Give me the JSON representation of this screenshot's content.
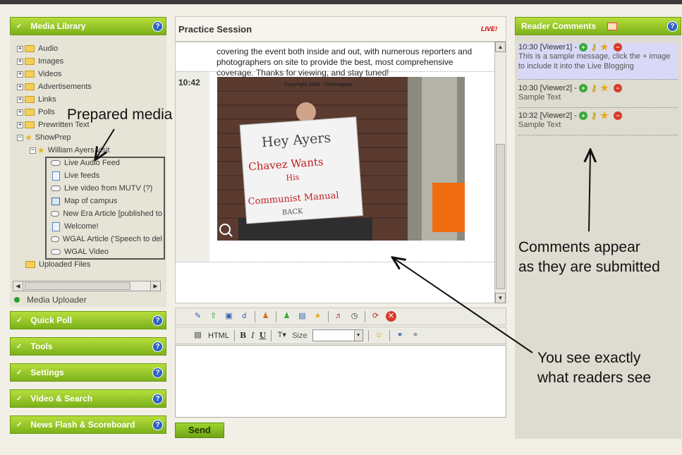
{
  "left_panel": {
    "media_library": "Media Library",
    "tree": [
      {
        "label": "Audio"
      },
      {
        "label": "Images"
      },
      {
        "label": "Videos"
      },
      {
        "label": "Advertisements"
      },
      {
        "label": "Links"
      },
      {
        "label": "Polls"
      },
      {
        "label": "Prewritten Text"
      },
      {
        "label": "ShowPrep"
      }
    ],
    "showprep_child": "William Ayers visit",
    "media_items": [
      {
        "label": "Live Audio Feed",
        "icon": "link-icon"
      },
      {
        "label": "Live feeds",
        "icon": "document-icon"
      },
      {
        "label": "Live video from MUTV (?)",
        "icon": "link-icon"
      },
      {
        "label": "Map of campus",
        "icon": "image-icon"
      },
      {
        "label": "New Era Article [published to",
        "icon": "link-icon"
      },
      {
        "label": "Welcome!",
        "icon": "document-icon"
      },
      {
        "label": "WGAL Article ('Speech to del",
        "icon": "link-icon"
      },
      {
        "label": "WGAL Video",
        "icon": "link-icon"
      }
    ],
    "uploaded_files": "Uploaded Files",
    "media_uploader": "Media Uploader",
    "panels": [
      "Quick Poll",
      "Tools",
      "Settings",
      "Video & Search",
      "News Flash & Scoreboard"
    ]
  },
  "session": {
    "title": "Practice Session",
    "live": "LIVE!",
    "intro_text": "covering the event both inside and out, with numerous reporters and photographers on site to provide the best, most comprehensive coverage. Thanks for viewing, and stay tuned!",
    "post_time": "10:42",
    "photo": {
      "copyright": "Copyright 2008 - TheSnapper",
      "sign_lines": [
        "Hey Ayers",
        "Chavez Wants",
        "His",
        "Communist Manual",
        "BACK"
      ]
    }
  },
  "editor_toolbar": {
    "html": "HTML",
    "bold": "B",
    "italic": "I",
    "underline": "U",
    "size_label": "Size",
    "send": "Send"
  },
  "right_panel": {
    "title": "Reader Comments",
    "comments": [
      {
        "meta": "10:30 [Viewer1] -",
        "text": "This is a sample message, click the + image to include it into the Live Blogging"
      },
      {
        "meta": "10:30 [Viewer2] -",
        "text": "Sample Text"
      },
      {
        "meta": "10:32 [Viewer2] -",
        "text": "Sample Text"
      }
    ]
  },
  "annotations": {
    "prepared_media": "Prepared media",
    "comments_line1": "Comments appear",
    "comments_line2": "as they are submitted",
    "readers_line1": "You see exactly",
    "readers_line2": "what readers see"
  }
}
